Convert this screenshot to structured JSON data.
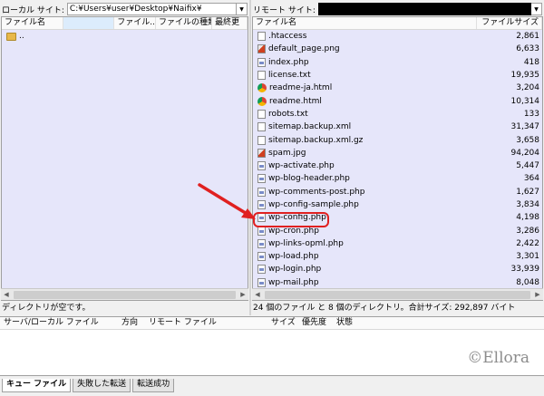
{
  "local": {
    "site_label": "ローカル サイト:",
    "path": "C:¥Users¥user¥Desktop¥Naifix¥",
    "columns": [
      "ファイル名",
      "",
      "ファイル...",
      "ファイルの種類",
      "最終更"
    ],
    "items": [
      {
        "name": "..",
        "icon": "folder-icon"
      }
    ],
    "status": "ディレクトリが空です。"
  },
  "remote": {
    "site_label": "リモート サイト:",
    "columns": [
      "ファイル名",
      "ファイルサイズ"
    ],
    "files": [
      {
        "name": ".htaccess",
        "size": "2,861",
        "icon": "doc-icon"
      },
      {
        "name": "default_page.png",
        "size": "6,633",
        "icon": "image-icon"
      },
      {
        "name": "index.php",
        "size": "418",
        "icon": "php-icon"
      },
      {
        "name": "license.txt",
        "size": "19,935",
        "icon": "doc-icon"
      },
      {
        "name": "readme-ja.html",
        "size": "3,204",
        "icon": "chrome-icon"
      },
      {
        "name": "readme.html",
        "size": "10,314",
        "icon": "chrome-icon"
      },
      {
        "name": "robots.txt",
        "size": "133",
        "icon": "doc-icon"
      },
      {
        "name": "sitemap.backup.xml",
        "size": "31,347",
        "icon": "doc-icon"
      },
      {
        "name": "sitemap.backup.xml.gz",
        "size": "3,658",
        "icon": "doc-icon"
      },
      {
        "name": "spam.jpg",
        "size": "94,204",
        "icon": "image-icon"
      },
      {
        "name": "wp-activate.php",
        "size": "5,447",
        "icon": "php-icon"
      },
      {
        "name": "wp-blog-header.php",
        "size": "364",
        "icon": "php-icon"
      },
      {
        "name": "wp-comments-post.php",
        "size": "1,627",
        "icon": "php-icon"
      },
      {
        "name": "wp-config-sample.php",
        "size": "3,834",
        "icon": "php-icon"
      },
      {
        "name": "wp-config.php",
        "size": "4,198",
        "icon": "php-icon"
      },
      {
        "name": "wp-cron.php",
        "size": "3,286",
        "icon": "php-icon"
      },
      {
        "name": "wp-links-opml.php",
        "size": "2,422",
        "icon": "php-icon"
      },
      {
        "name": "wp-load.php",
        "size": "3,301",
        "icon": "php-icon"
      },
      {
        "name": "wp-login.php",
        "size": "33,939",
        "icon": "php-icon"
      },
      {
        "name": "wp-mail.php",
        "size": "8,048",
        "icon": "php-icon"
      }
    ],
    "status": "24 個のファイル と 8 個のディレクトリ。合計サイズ: 292,897 バイト"
  },
  "queue": {
    "columns": [
      "サーバ/ローカル ファイル",
      "方向",
      "リモート ファイル",
      "サイズ",
      "優先度",
      "状態"
    ],
    "watermark": "©Ellora"
  },
  "tabs": [
    "キュー ファイル",
    "失敗した転送",
    "転送成功"
  ],
  "colors": {
    "list_background": "#e6e6fa",
    "highlight": "#e02020"
  }
}
